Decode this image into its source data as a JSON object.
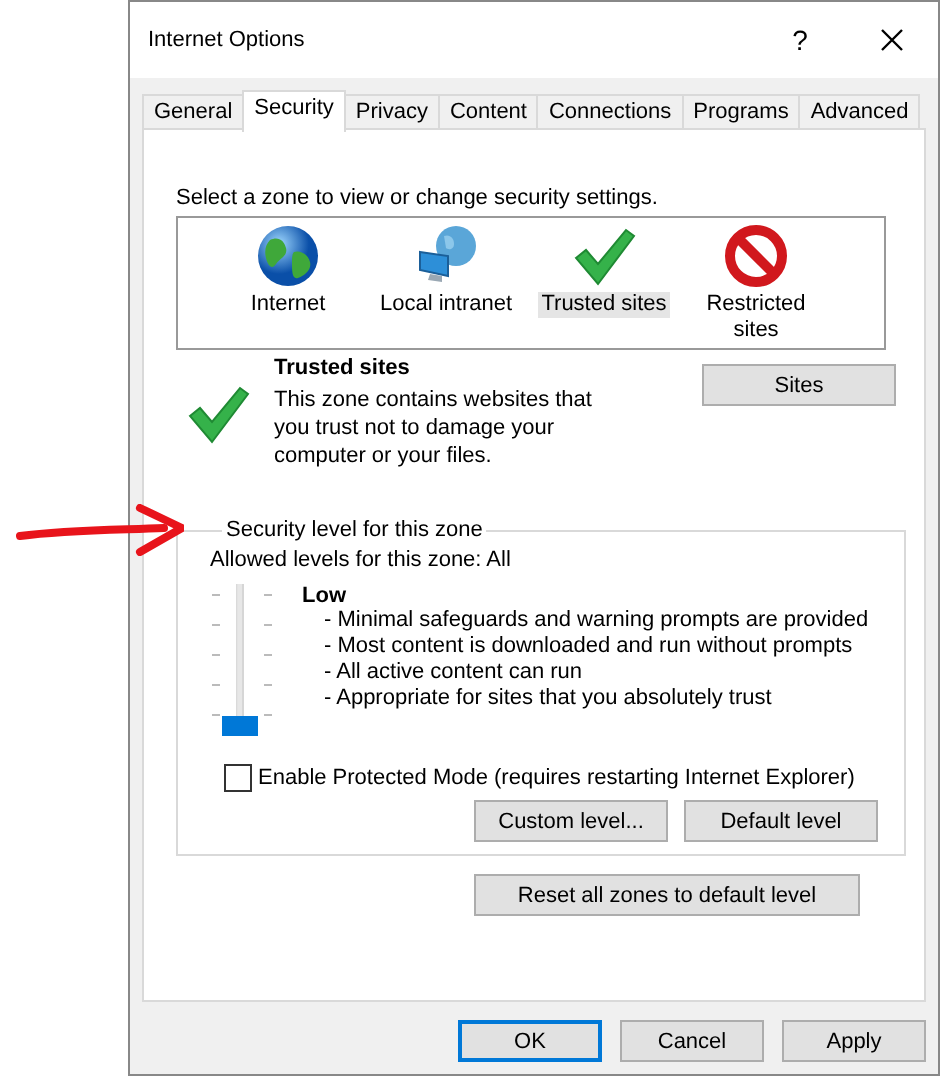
{
  "window": {
    "title": "Internet Options",
    "help_button": "?"
  },
  "tabs": [
    {
      "label": "General",
      "selected": false
    },
    {
      "label": "Security",
      "selected": true
    },
    {
      "label": "Privacy",
      "selected": false
    },
    {
      "label": "Content",
      "selected": false
    },
    {
      "label": "Connections",
      "selected": false
    },
    {
      "label": "Programs",
      "selected": false
    },
    {
      "label": "Advanced",
      "selected": false
    }
  ],
  "zone_prompt": "Select a zone to view or change security settings.",
  "zones": [
    {
      "label": "Internet",
      "kind": "globe",
      "selected": false
    },
    {
      "label": "Local intranet",
      "kind": "intranet",
      "selected": false
    },
    {
      "label": "Trusted sites",
      "kind": "check",
      "selected": true
    },
    {
      "label": "Restricted sites",
      "kind": "blocked",
      "selected": false
    }
  ],
  "zone_info": {
    "kind": "check",
    "title": "Trusted sites",
    "description": "This zone contains websites that you trust not to damage your computer or your files.",
    "sites_button": "Sites"
  },
  "security_level": {
    "legend": "Security level for this zone",
    "allowed": "Allowed levels for this zone: All",
    "level": 0,
    "level_name": "Low",
    "bullets": [
      "- Minimal safeguards and warning prompts are provided",
      "- Most content is downloaded and run without prompts",
      "- All active content can run",
      "- Appropriate for sites that you absolutely trust"
    ],
    "protected_mode": {
      "label": "Enable Protected Mode (requires restarting Internet Explorer)",
      "checked": false
    },
    "buttons": [
      "Custom level...",
      "Default level"
    ]
  },
  "reset_button": "Reset all zones to default level",
  "footer_buttons": [
    {
      "label": "OK",
      "focused": true
    },
    {
      "label": "Cancel",
      "focused": false
    },
    {
      "label": "Apply",
      "focused": false
    }
  ]
}
